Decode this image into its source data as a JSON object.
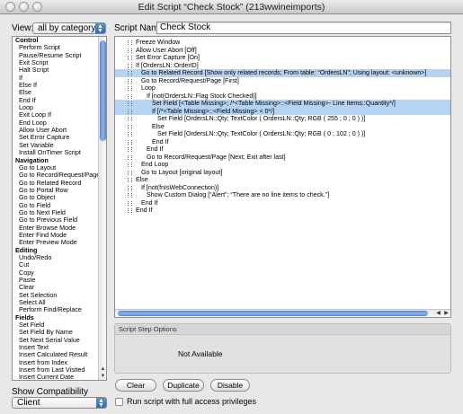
{
  "window": {
    "title": "Edit Script “Check Stock” (213wwineimports)"
  },
  "view": {
    "label": "View:",
    "selected": "all by category"
  },
  "script_name": {
    "label": "Script Name:",
    "value": "Check Stock"
  },
  "steps_list": [
    {
      "label": "Control",
      "category": true
    },
    {
      "label": "Perform Script"
    },
    {
      "label": "Pause/Resume Script"
    },
    {
      "label": "Exit Script"
    },
    {
      "label": "Halt Script"
    },
    {
      "label": "If"
    },
    {
      "label": "Else If"
    },
    {
      "label": "Else"
    },
    {
      "label": "End If"
    },
    {
      "label": "Loop"
    },
    {
      "label": "Exit Loop If"
    },
    {
      "label": "End Loop"
    },
    {
      "label": "Allow User Abort"
    },
    {
      "label": "Set Error Capture"
    },
    {
      "label": "Set Variable"
    },
    {
      "label": "Install OnTimer Script"
    },
    {
      "label": "Navigation",
      "category": true
    },
    {
      "label": "Go to Layout"
    },
    {
      "label": "Go to Record/Request/Page"
    },
    {
      "label": "Go to Related Record"
    },
    {
      "label": "Go to Portal Row"
    },
    {
      "label": "Go to Object"
    },
    {
      "label": "Go to Field"
    },
    {
      "label": "Go to Next Field"
    },
    {
      "label": "Go to Previous Field"
    },
    {
      "label": "Enter Browse Mode"
    },
    {
      "label": "Enter Find Mode"
    },
    {
      "label": "Enter Preview Mode"
    },
    {
      "label": "Editing",
      "category": true
    },
    {
      "label": "Undo/Redo"
    },
    {
      "label": "Cut"
    },
    {
      "label": "Copy"
    },
    {
      "label": "Paste"
    },
    {
      "label": "Clear"
    },
    {
      "label": "Set Selection"
    },
    {
      "label": "Select All"
    },
    {
      "label": "Perform Find/Replace"
    },
    {
      "label": "Fields",
      "category": true
    },
    {
      "label": "Set Field"
    },
    {
      "label": "Set Field By Name"
    },
    {
      "label": "Set Next Serial Value"
    },
    {
      "label": "Insert Text"
    },
    {
      "label": "Insert Calculated Result"
    },
    {
      "label": "Insert from Index"
    },
    {
      "label": "Insert from Last Visited"
    },
    {
      "label": "Insert Current Date"
    }
  ],
  "script_lines": [
    {
      "text": "Freeze Window",
      "indent": 0
    },
    {
      "text": "Allow User Abort [Off]",
      "indent": 0
    },
    {
      "text": "Set Error Capture [On]",
      "indent": 0
    },
    {
      "text": "If [OrdersLN::OrderID]",
      "indent": 0
    },
    {
      "text": "Go to Related Record [Show only related records; From table: “OrdersLN”; Using layout: <unknown>]",
      "indent": 1,
      "selected": true
    },
    {
      "text": "Go to Record/Request/Page [First]",
      "indent": 1
    },
    {
      "text": "Loop",
      "indent": 1
    },
    {
      "text": "If [not(OrdersLN::Flag Stock Checked)]",
      "indent": 2
    },
    {
      "text": "Set Field [<Table Missing>; /*<Table Missing>::<Field Missing>- Line Items::Quantity*/]",
      "indent": 3,
      "selected": true
    },
    {
      "text": "If [/*<Table Missing>::<Field Missing> < 0*/]",
      "indent": 3,
      "selected": true
    },
    {
      "text": "Set Field [OrdersLN::Qty; TextColor ( OrdersLN::Qty; RGB ( 255 ; 0 ; 0 ) )]",
      "indent": 4
    },
    {
      "text": "Else",
      "indent": 3
    },
    {
      "text": "Set Field [OrdersLN::Qty; TextColor ( OrdersLN::Qty; RGB ( 0 ; 102 ; 0 ) )]",
      "indent": 4
    },
    {
      "text": "End If",
      "indent": 3
    },
    {
      "text": "End If",
      "indent": 2
    },
    {
      "text": "Go to Record/Request/Page [Next; Exit after last]",
      "indent": 2
    },
    {
      "text": "End Loop",
      "indent": 1
    },
    {
      "text": "Go to Layout [original layout]",
      "indent": 1
    },
    {
      "text": "Else",
      "indent": 0
    },
    {
      "text": "If [not(fnIsWebConnection)]",
      "indent": 1
    },
    {
      "text": "Show Custom Dialog [“Alert”; “There are no line items to check.”]",
      "indent": 2
    },
    {
      "text": "End If",
      "indent": 1
    },
    {
      "text": "End If",
      "indent": 0
    }
  ],
  "options": {
    "header": "Script Step Options",
    "body": "Not Available"
  },
  "buttons": {
    "clear": "Clear",
    "duplicate": "Duplicate",
    "disable": "Disable"
  },
  "compat": {
    "label": "Show Compatibility",
    "selected": "Client"
  },
  "full_access": {
    "label": "Run script with full access privileges",
    "checked": false
  },
  "colors": {
    "selection": "#b5d3f5",
    "accent": "#3d74cf"
  }
}
